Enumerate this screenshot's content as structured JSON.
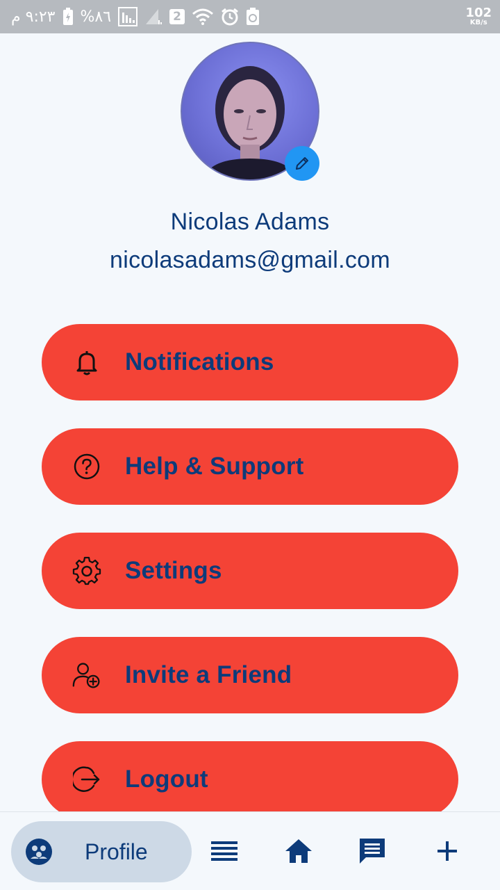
{
  "status_bar": {
    "time": "٩:٢٣ م",
    "battery": "%٨٦",
    "sim_badge": "2",
    "net_speed": "102",
    "net_unit": "KB/s"
  },
  "profile": {
    "name": "Nicolas Adams",
    "email": "nicolasadams@gmail.com"
  },
  "menu": [
    {
      "label": "Notifications",
      "icon": "bell-icon"
    },
    {
      "label": "Help & Support",
      "icon": "help-circle-icon"
    },
    {
      "label": "Settings",
      "icon": "gear-icon"
    },
    {
      "label": "Invite a Friend",
      "icon": "user-add-icon"
    },
    {
      "label": "Logout",
      "icon": "logout-icon"
    }
  ],
  "bottom_nav": {
    "active_label": "Profile",
    "items": [
      "profile-icon",
      "list-icon",
      "home-icon",
      "chat-icon",
      "plus-icon"
    ]
  },
  "colors": {
    "accent": "#f44336",
    "text": "#0d3b7a",
    "edit": "#2196f3",
    "background": "#f4f8fc"
  }
}
